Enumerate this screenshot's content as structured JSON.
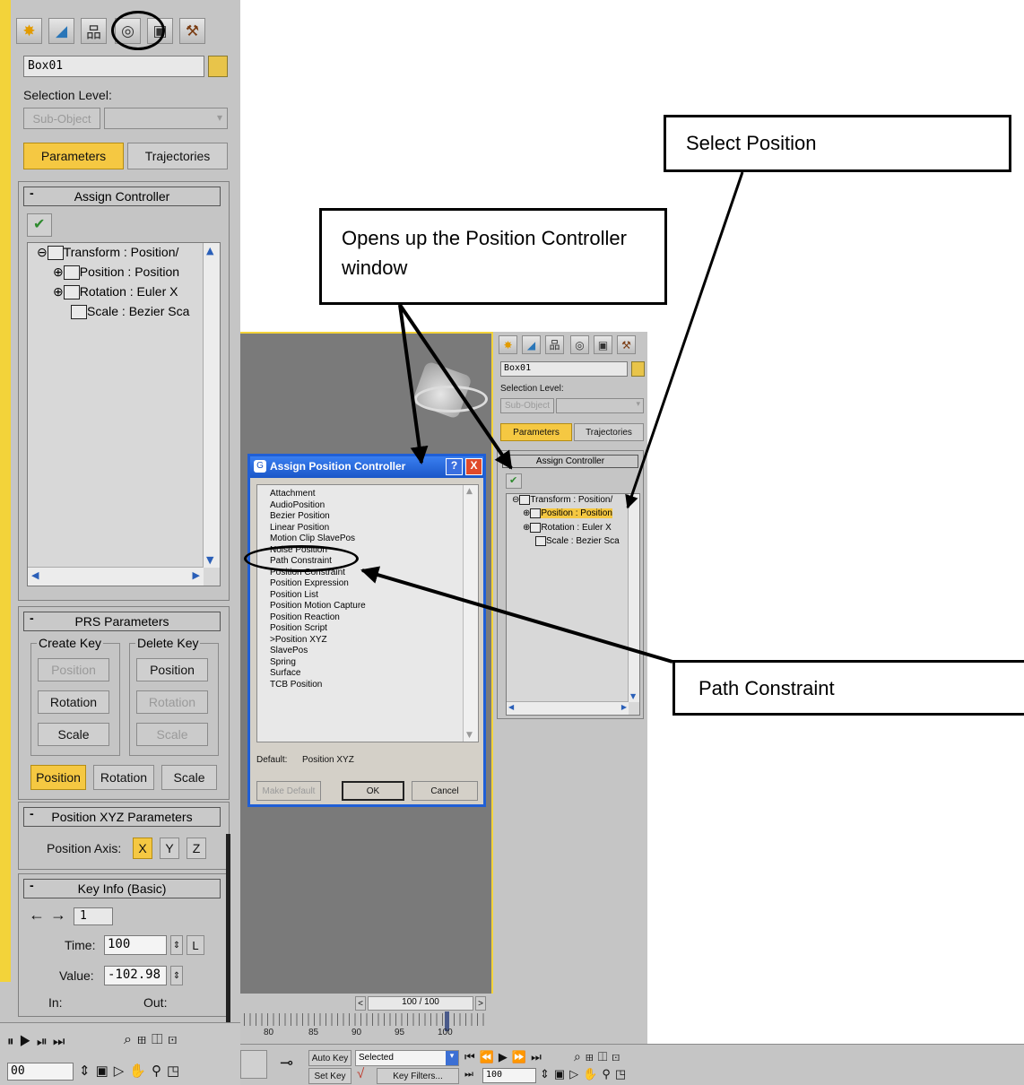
{
  "command_tabs": [
    "create-icon",
    "modify-icon",
    "hierarchy-icon",
    "motion-icon",
    "display-icon",
    "utilities-icon"
  ],
  "panel": {
    "object_name": "Box01",
    "selection_level_label": "Selection Level:",
    "sub_object_label": "Sub-Object",
    "parameters_label": "Parameters",
    "trajectories_label": "Trajectories"
  },
  "assign_controller": {
    "title": "Assign Controller",
    "minus": "-",
    "tree": [
      "Transform : Position/",
      "Position : Position",
      "Rotation : Euler X",
      "Scale : Bezier Sca"
    ]
  },
  "prs": {
    "title": "PRS Parameters",
    "create_key": "Create Key",
    "delete_key": "Delete Key",
    "position": "Position",
    "rotation": "Rotation",
    "scale": "Scale"
  },
  "pos_xyz": {
    "title": "Position XYZ Parameters",
    "axis_label": "Position Axis:",
    "x": "X",
    "y": "Y",
    "z": "Z"
  },
  "key_info": {
    "title": "Key Info (Basic)",
    "key_number": "1",
    "time_label": "Time:",
    "time_value": "100",
    "lock": "L",
    "value_label": "Value:",
    "value": "-102.98",
    "in_label": "In:",
    "out_label": "Out:"
  },
  "left_bottom": {
    "frame_field": "00"
  },
  "dialog": {
    "title": "Assign Position Controller",
    "help": "?",
    "close": "X",
    "items": [
      "Attachment",
      "AudioPosition",
      "Bezier Position",
      "Linear Position",
      "Motion Clip SlavePos",
      "Noise Position",
      "Path Constraint",
      "Position Constraint",
      "Position Expression",
      "Position List",
      "Position Motion Capture",
      "Position Reaction",
      "Position Script",
      ">Position XYZ",
      "SlavePos",
      "Spring",
      "Surface",
      "TCB Position"
    ],
    "default_label": "Default:",
    "default_value": "Position XYZ",
    "make_default": "Make Default",
    "ok": "OK",
    "cancel": "Cancel"
  },
  "timeline": {
    "frame_counter": "100 / 100",
    "prev": "<",
    "next": ">",
    "ticks": [
      "80",
      "85",
      "90",
      "95",
      "100"
    ]
  },
  "bottom_bar": {
    "auto_key": "Auto Key",
    "selected": "Selected",
    "set_key": "Set Key",
    "key_filters": "Key Filters...",
    "frame_field": "100"
  },
  "callouts": {
    "select_position": "Select Position",
    "opens_up": "Opens up the Position Controller window",
    "path_constraint": "Path Constraint"
  },
  "colors": {
    "panel": "#c5c5c5",
    "active": "#f5c842",
    "viewport": "#7a7a7a",
    "dialog_title": "#1f5fd6"
  }
}
